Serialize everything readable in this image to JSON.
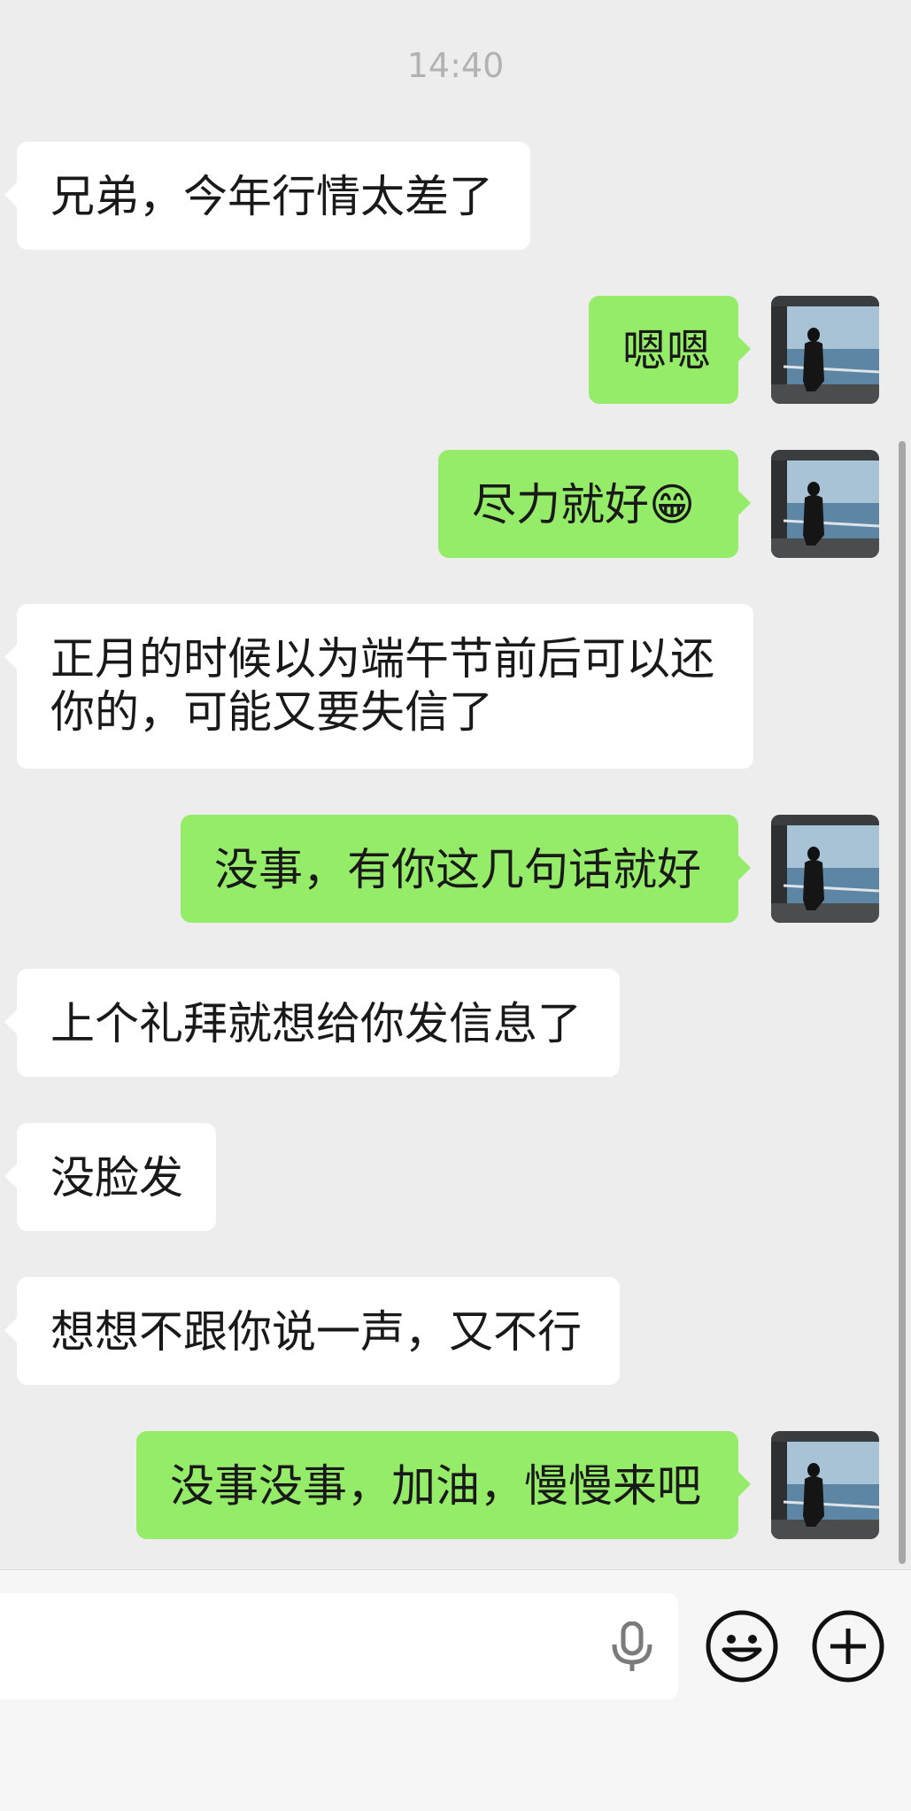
{
  "chat": {
    "timestamp": "14:40",
    "messages": [
      {
        "side": "in",
        "text": "兄弟，今年行情太差了"
      },
      {
        "side": "out",
        "text": "嗯嗯"
      },
      {
        "side": "out",
        "text": "尽力就好😁"
      },
      {
        "side": "in",
        "text": "正月的时候以为端午节前后可以还你的，可能又要失信了"
      },
      {
        "side": "out",
        "text": "没事，有你这几句话就好"
      },
      {
        "side": "in",
        "text": "上个礼拜就想给你发信息了"
      },
      {
        "side": "in",
        "text": "没脸发"
      },
      {
        "side": "in",
        "text": "想想不跟你说一声，又不行"
      },
      {
        "side": "out",
        "text": "没事没事，加油，慢慢来吧"
      }
    ]
  },
  "input_bar": {
    "mic_icon": "microphone-icon",
    "emoji_icon": "smiley-face-icon",
    "more_icon": "plus-circle-icon"
  },
  "colors": {
    "background": "#ededed",
    "incoming_bubble": "#ffffff",
    "outgoing_bubble": "#95ec69",
    "timestamp": "#b2b2b2"
  }
}
